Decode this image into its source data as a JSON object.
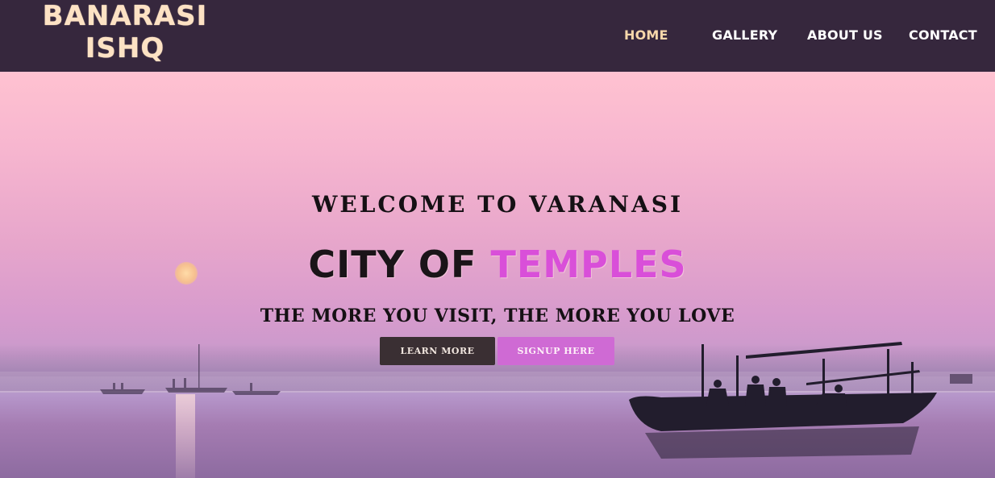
{
  "header": {
    "brand_line1": "BANARASI",
    "brand_line2": "ISHQ",
    "nav": {
      "home": "HOME",
      "gallery": "GALLERY",
      "about": "ABOUT US",
      "contact": "CONTACT"
    }
  },
  "hero": {
    "welcome": "WELCOME TO VARANASI",
    "title_part1": "CITY OF ",
    "title_part2": "TEMPLES",
    "tagline": "THE MORE YOU VISIT, THE MORE YOU LOVE",
    "buttons": {
      "learn_more": "LEARN MORE",
      "signup": "SIGNUP HERE"
    }
  },
  "colors": {
    "nav_bg": "#36273d",
    "brand": "#fde2c4",
    "nav_active": "#f7d7aa",
    "accent": "#d94fd9",
    "learn_btn": "#3a2f33",
    "signup_btn": "#cf6ad4"
  }
}
